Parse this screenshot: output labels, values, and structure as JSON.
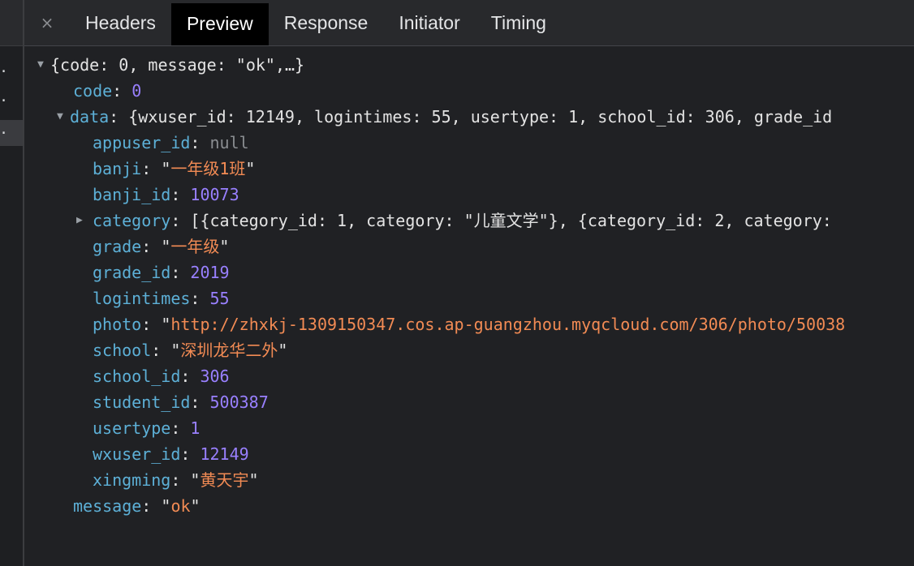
{
  "tabs": {
    "close": "×",
    "items": [
      "Headers",
      "Preview",
      "Response",
      "Initiator",
      "Timing"
    ],
    "active": "Preview"
  },
  "left_rows": [
    "..",
    ".",
    "."
  ],
  "tree": {
    "root_summary": "{code: 0, message: \"ok\",…}",
    "code": {
      "key": "code",
      "value": "0"
    },
    "data": {
      "key": "data",
      "summary": "{wxuser_id: 12149, logintimes: 55, usertype: 1, school_id: 306, grade_id",
      "fields": {
        "appuser_id": {
          "key": "appuser_id",
          "value": "null"
        },
        "banji": {
          "key": "banji",
          "value": "一年级1班"
        },
        "banji_id": {
          "key": "banji_id",
          "value": "10073"
        },
        "category": {
          "key": "category",
          "summary": "[{category_id: 1, category: \"儿童文学\"}, {category_id: 2, category:"
        },
        "grade": {
          "key": "grade",
          "value": "一年级"
        },
        "grade_id": {
          "key": "grade_id",
          "value": "2019"
        },
        "logintimes": {
          "key": "logintimes",
          "value": "55"
        },
        "photo": {
          "key": "photo",
          "value": "http://zhxkj-1309150347.cos.ap-guangzhou.myqcloud.com/306/photo/50038"
        },
        "school": {
          "key": "school",
          "value": "深圳龙华二外"
        },
        "school_id": {
          "key": "school_id",
          "value": "306"
        },
        "student_id": {
          "key": "student_id",
          "value": "500387"
        },
        "usertype": {
          "key": "usertype",
          "value": "1"
        },
        "wxuser_id": {
          "key": "wxuser_id",
          "value": "12149"
        },
        "xingming": {
          "key": "xingming",
          "value": "黄天宇"
        }
      }
    },
    "message": {
      "key": "message",
      "value": "ok"
    }
  },
  "colors": {
    "background": "#202124",
    "key": "#5db0d7",
    "number": "#9980ff",
    "string": "#f28b54",
    "null": "#8a8d91"
  }
}
